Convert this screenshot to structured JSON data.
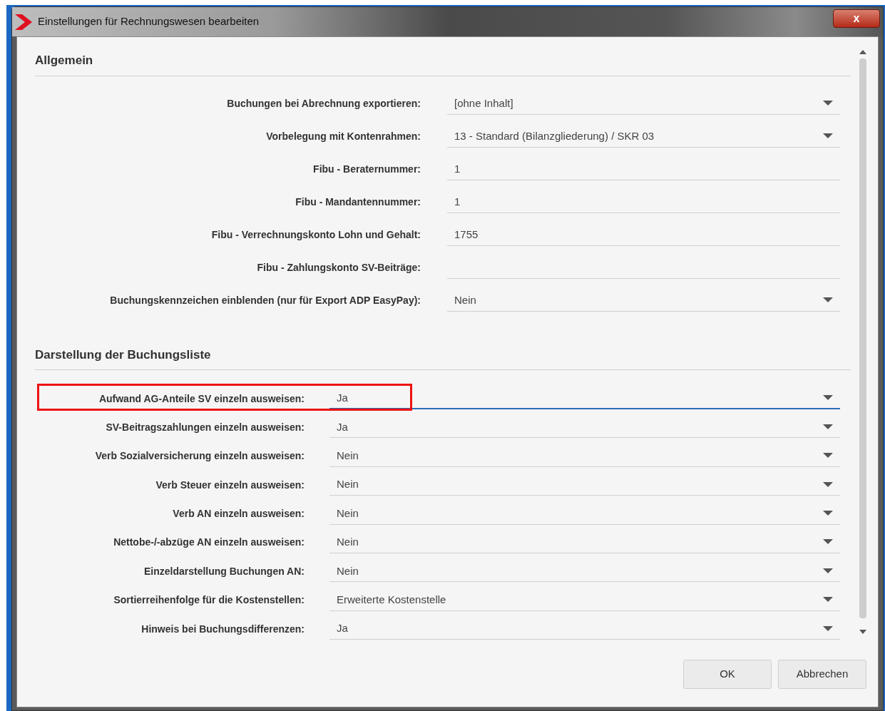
{
  "window": {
    "title": "Einstellungen für Rechnungswesen bearbeiten",
    "close_label": "x"
  },
  "sections": [
    {
      "title": "Allgemein",
      "rows": [
        {
          "label": "Buchungen bei Abrechnung exportieren:",
          "kind": "dropdown",
          "value": "[ohne Inhalt]",
          "focused": false,
          "highlighted": false
        },
        {
          "label": "Vorbelegung mit Kontenrahmen:",
          "kind": "dropdown",
          "value": "13 - Standard (Bilanzgliederung) / SKR 03",
          "focused": false,
          "highlighted": false
        },
        {
          "label": "Fibu - Beraternummer:",
          "kind": "text",
          "value": "1",
          "focused": false,
          "highlighted": false
        },
        {
          "label": "Fibu - Mandantennummer:",
          "kind": "text",
          "value": "1",
          "focused": false,
          "highlighted": false
        },
        {
          "label": "Fibu - Verrechnungskonto Lohn und Gehalt:",
          "kind": "text",
          "value": "1755",
          "focused": false,
          "highlighted": false
        },
        {
          "label": "Fibu - Zahlungskonto SV-Beiträge:",
          "kind": "text",
          "focused": false,
          "highlighted": false
        },
        {
          "label": "Buchungskennzeichen einblenden (nur für Export ADP EasyPay):",
          "kind": "dropdown",
          "value": "Nein",
          "focused": false,
          "highlighted": false
        }
      ]
    },
    {
      "title": "Darstellung der Buchungsliste",
      "rows": [
        {
          "label": "Aufwand AG-Anteile SV einzeln ausweisen:",
          "kind": "dropdown",
          "value": "Ja",
          "focused": true,
          "highlighted": true
        },
        {
          "label": "SV-Beitragszahlungen einzeln ausweisen:",
          "kind": "dropdown",
          "value": "Ja",
          "focused": false,
          "highlighted": false
        },
        {
          "label": "Verb Sozialversicherung einzeln ausweisen:",
          "kind": "dropdown",
          "value": "Nein",
          "focused": false,
          "highlighted": false
        },
        {
          "label": "Verb Steuer einzeln ausweisen:",
          "kind": "dropdown",
          "value": "Nein",
          "focused": false,
          "highlighted": false
        },
        {
          "label": "Verb AN einzeln ausweisen:",
          "kind": "dropdown",
          "value": "Nein",
          "focused": false,
          "highlighted": false
        },
        {
          "label": "Nettobe-/-abzüge AN einzeln ausweisen:",
          "kind": "dropdown",
          "value": "Nein",
          "focused": false,
          "highlighted": false
        },
        {
          "label": "Einzeldarstellung Buchungen AN:",
          "kind": "dropdown",
          "value": "Nein",
          "focused": false,
          "highlighted": false
        },
        {
          "label": "Sortierreihenfolge für die Kostenstellen:",
          "kind": "dropdown",
          "value": "Erweiterte Kostenstelle",
          "focused": false,
          "highlighted": false
        },
        {
          "label": "Hinweis bei Buchungsdifferenzen:",
          "kind": "dropdown",
          "value": "Ja",
          "focused": false,
          "highlighted": false
        }
      ]
    }
  ],
  "buttons": [
    "OK",
    "Abbrechen"
  ]
}
